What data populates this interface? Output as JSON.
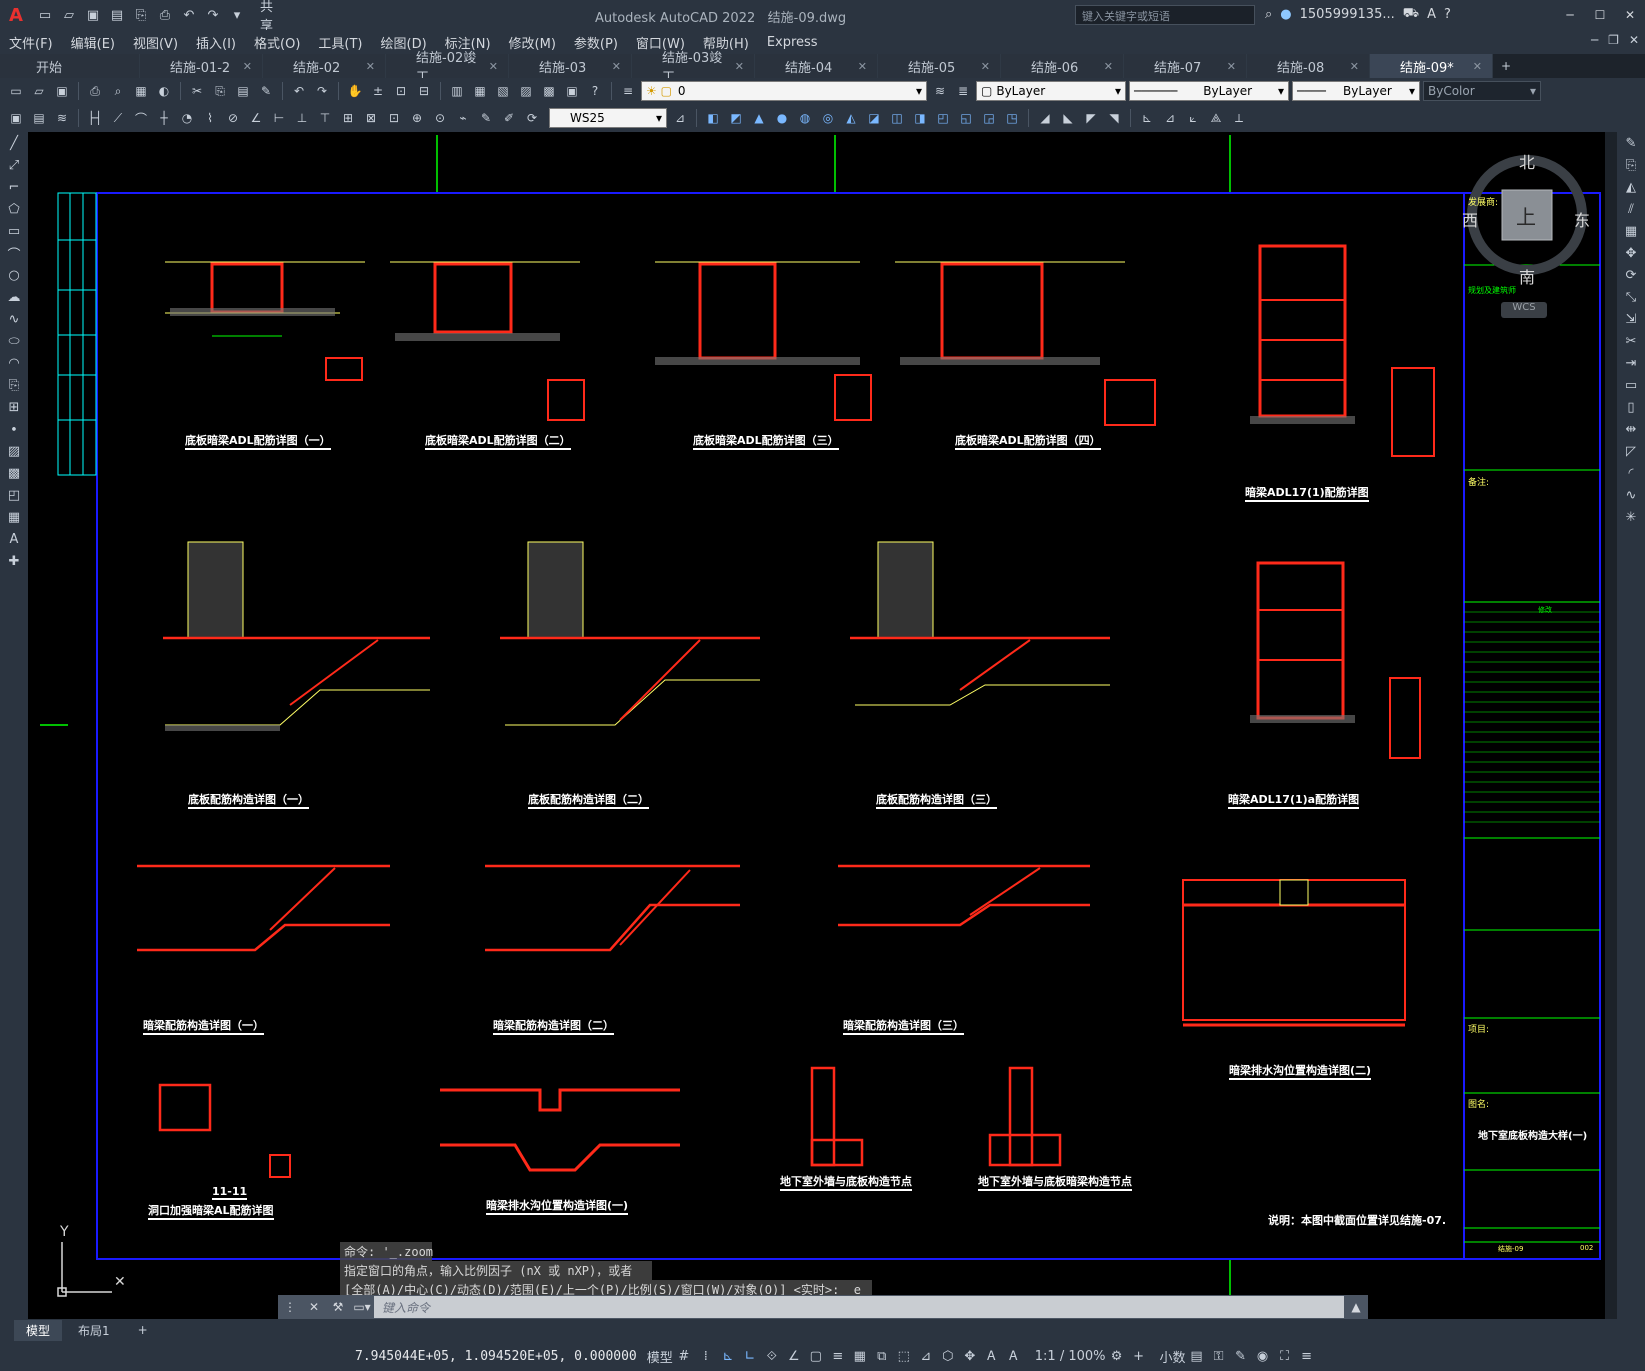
{
  "window": {
    "title": "Autodesk AutoCAD 2022",
    "filename": "结施-09.dwg",
    "share": "共享",
    "search_placeholder": "键入关键字或短语",
    "user": "1505999135...",
    "min": "─",
    "max": "☐",
    "close": "✕"
  },
  "menu": [
    "文件(F)",
    "编辑(E)",
    "视图(V)",
    "插入(I)",
    "格式(O)",
    "工具(T)",
    "绘图(D)",
    "标注(N)",
    "修改(M)",
    "参数(P)",
    "窗口(W)",
    "帮助(H)",
    "Express"
  ],
  "doc_tabs": [
    "开始",
    "结施-01-2",
    "结施-02",
    "结施-02竣工",
    "结施-03",
    "结施-03竣工",
    "结施-04",
    "结施-05",
    "结施-06",
    "结施-07",
    "结施-08",
    "结施-09*"
  ],
  "layer": {
    "current": "0",
    "color": "ByLayer",
    "linetype": "ByLayer",
    "lineweight": "ByLayer",
    "plotstyle": "ByColor"
  },
  "dimstyle": "WS25",
  "viewcube": {
    "north": "北",
    "south": "南",
    "east": "东",
    "west": "西",
    "top": "上",
    "wcs": "WCS"
  },
  "drawing": {
    "row1": [
      "底板暗梁ADL配筋详图（一）",
      "底板暗梁ADL配筋详图（二）",
      "底板暗梁ADL配筋详图（三）",
      "底板暗梁ADL配筋详图（四）",
      "暗梁ADL17(1)配筋详图"
    ],
    "row2": [
      "底板配筋构造详图（一）",
      "底板配筋构造详图（二）",
      "底板配筋构造详图（三）",
      "暗梁ADL17(1)a配筋详图"
    ],
    "row3": [
      "暗梁配筋构造详图（一）",
      "暗梁配筋构造详图（二）",
      "暗梁配筋构造详图（三）",
      "暗梁排水沟位置构造详图(二)"
    ],
    "row4": [
      "11-11",
      "洞口加强暗梁AL配筋详图",
      "暗梁排水沟位置构造详图(一)",
      "地下室外墙与底板构造节点",
      "地下室外墙与底板暗梁构造节点"
    ],
    "note": "说明：本图中截面位置详见结施-07.",
    "titleblock": {
      "owner": "发展商:",
      "design": "规划及建筑师",
      "notes": "备注:",
      "rev": "修改",
      "project": "项目:",
      "drawing_name": "图名:",
      "drawing_title": "地下室底板构造大样(一)",
      "dwg_no": "结施-09",
      "num": "002"
    }
  },
  "commands": [
    "命令: '_.zoom",
    "指定窗口的角点，输入比例因子 (nX 或 nXP)，或者",
    "[全部(A)/中心(C)/动态(D)/范围(E)/上一个(P)/比例(S)/窗口(W)/对象(O)] <实时>: _e"
  ],
  "cmd_placeholder": "键入命令",
  "layouts": [
    "模型",
    "布局1"
  ],
  "status": {
    "coords": "7.945044E+05, 1.094520E+05, 0.000000",
    "model": "模型",
    "scale": "1:1 / 100%",
    "units": "小数"
  },
  "colors": {
    "accent": "#3b8fdd",
    "line_green": "#00ff00",
    "rebar_red": "#ff2a1a",
    "frame_blue": "#1a1aff",
    "text_yellow": "#ffff66",
    "cyan": "#00ffff"
  }
}
